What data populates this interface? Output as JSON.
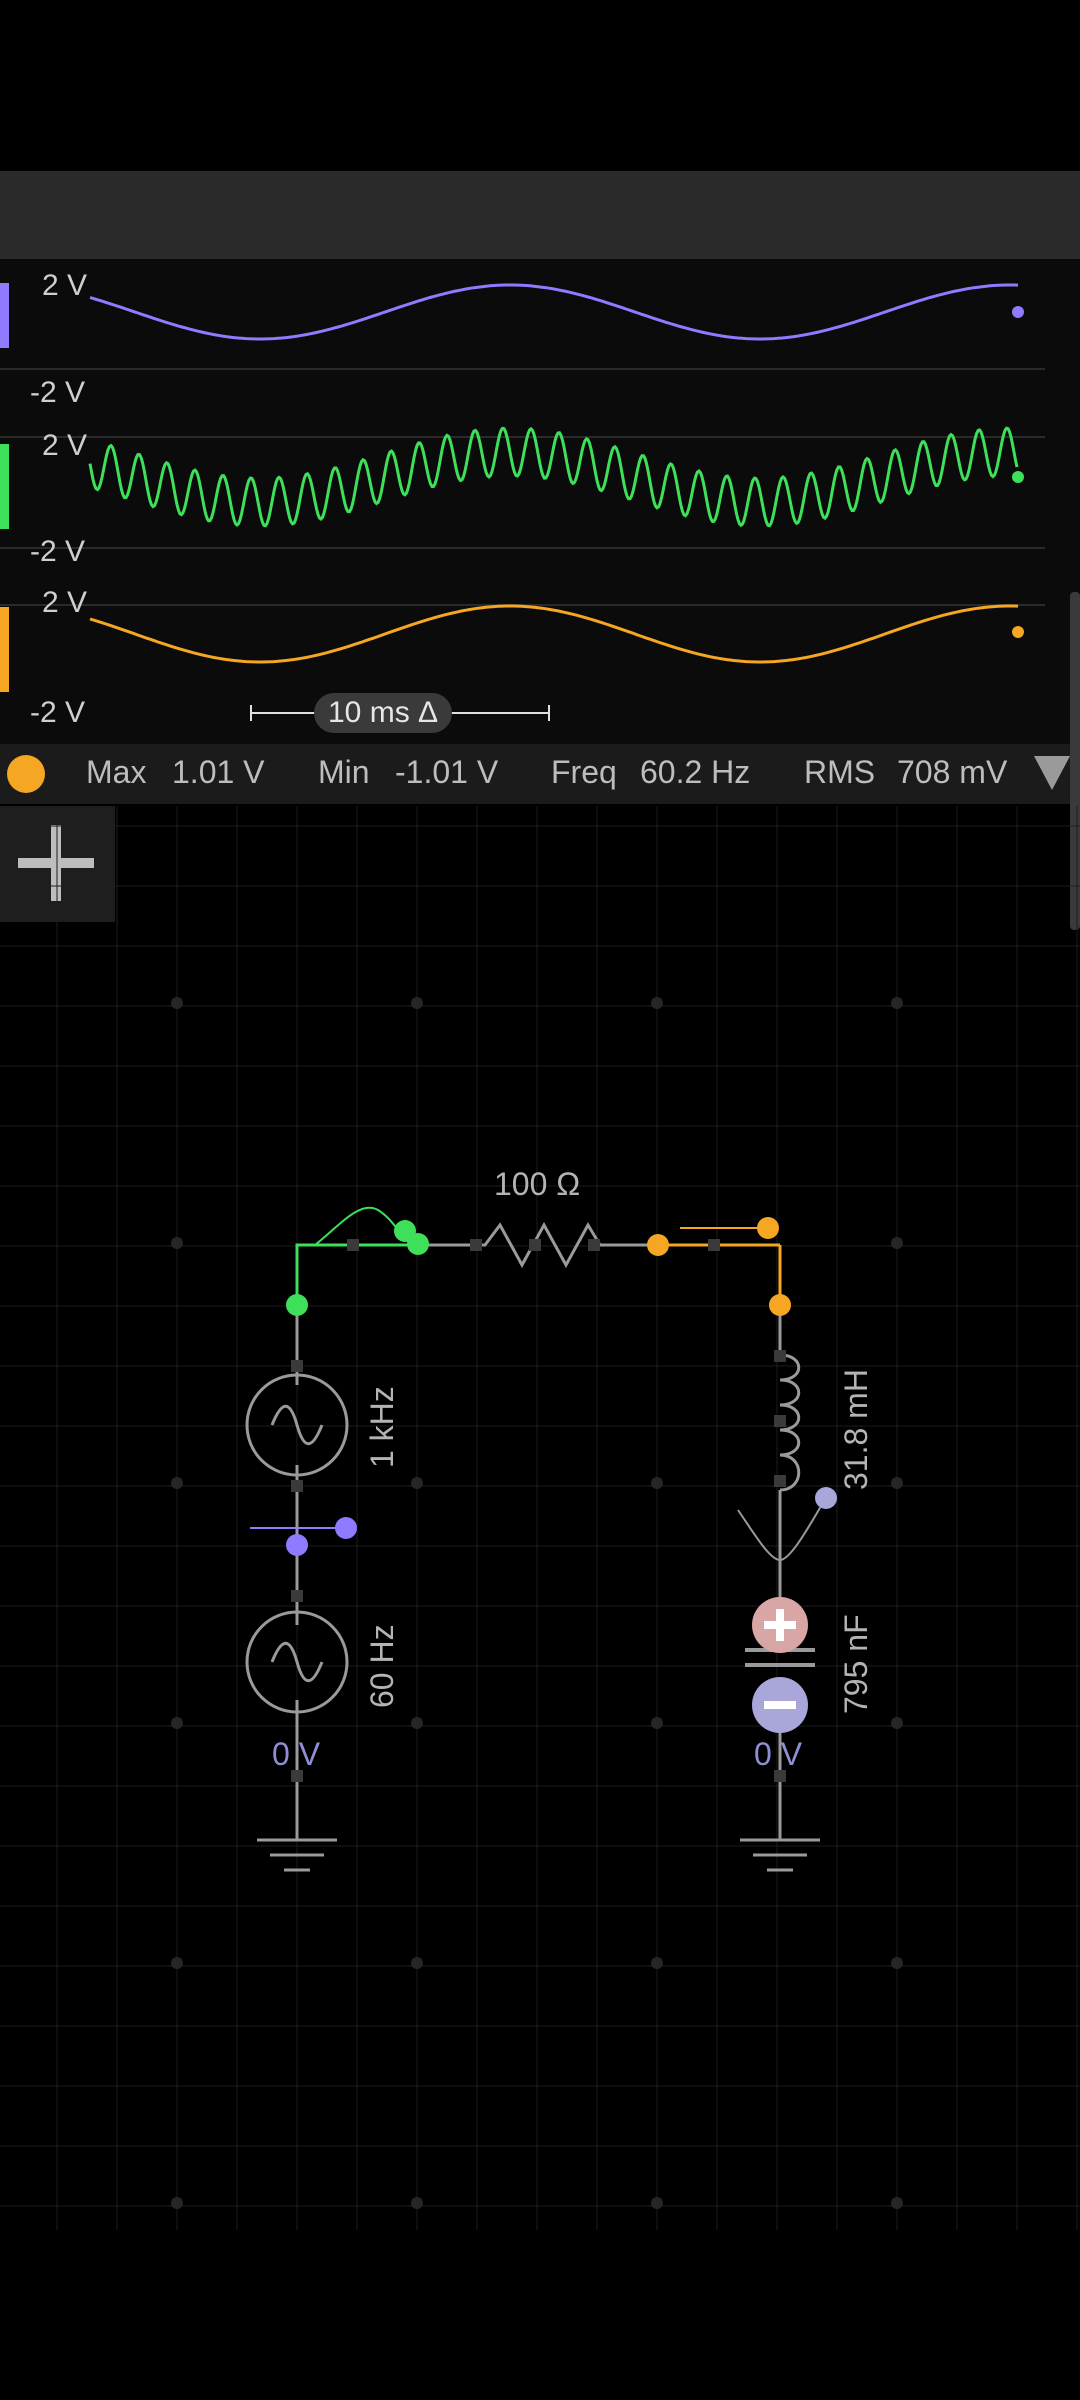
{
  "scope": {
    "channels": [
      {
        "name": "purple",
        "color": "#8f7bff",
        "top_label": "2 V",
        "bottom_label": "-2 V"
      },
      {
        "name": "green",
        "color": "#3ee05a",
        "top_label": "2 V",
        "bottom_label": "-2 V"
      },
      {
        "name": "orange",
        "color": "#f5a623",
        "top_label": "2 V",
        "bottom_label": "-2 V"
      }
    ],
    "timebase": "10 ms Δ"
  },
  "measurements": {
    "max_label": "Max",
    "max_value": "1.01 V",
    "min_label": "Min",
    "min_value": "-1.01 V",
    "freq_label": "Freq",
    "freq_value": "60.2 Hz",
    "rms_label": "RMS",
    "rms_value": "708 mV"
  },
  "circuit": {
    "resistor": "100 Ω",
    "source1_freq": "1 kHz",
    "source2_freq": "60 Hz",
    "inductor": "31.8 mH",
    "capacitor": "795 nF",
    "left_ground_voltage": "0 V",
    "right_ground_voltage": "0 V"
  },
  "icons": {
    "add": "plus-icon",
    "measure_menu": "triangle-down-icon",
    "channel_dot": "orange-circle-icon"
  }
}
